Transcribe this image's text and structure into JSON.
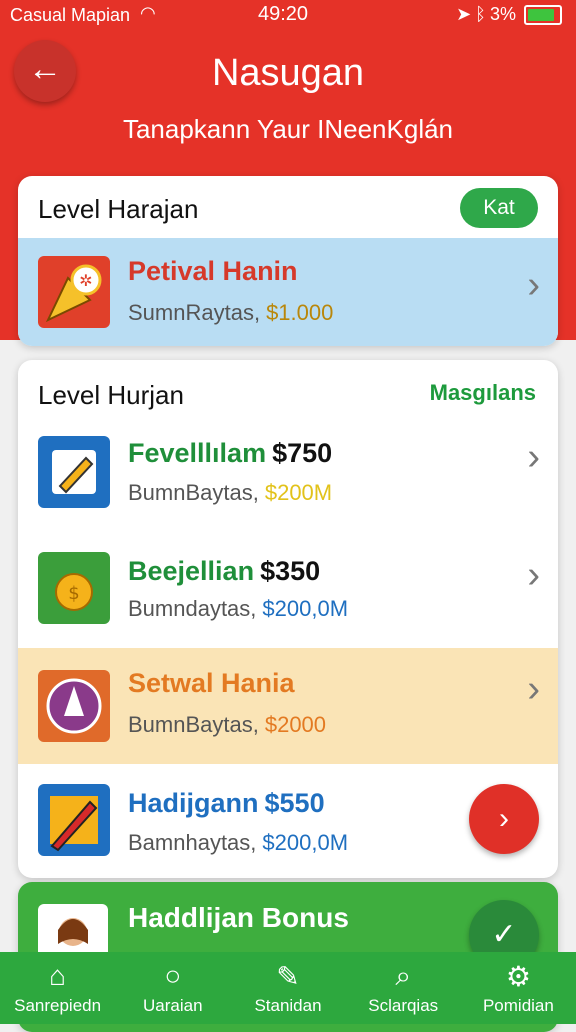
{
  "status": {
    "carrier": "Casual Mapian",
    "time": "49:20",
    "battery": "3%"
  },
  "header": {
    "title": "Nasugan",
    "subtitle": "Tanapkann Yaur INeenKglán"
  },
  "card1": {
    "title": "Level Harajan",
    "button": "Kat",
    "item": {
      "name": "Petival Hanin",
      "sub": "SumnRaytas,",
      "amount": "$1.000"
    }
  },
  "card2": {
    "title": "Level Hurjan",
    "action": "Masgılans",
    "items": [
      {
        "name": "Fevelllılam",
        "price": "$750",
        "sub": "BumnBaytas,",
        "amount": "$200M"
      },
      {
        "name": "Beejellian",
        "price": "$350",
        "sub": "Bumndaytas,",
        "amount": "$200,0M"
      },
      {
        "name": "Setwal Hania",
        "price": "",
        "sub": "BumnBaytas,",
        "amount": "$2000"
      },
      {
        "name": "Hadijgann",
        "price": "$550",
        "sub": "Bamnhaytas,",
        "amount": "$200,0M"
      }
    ]
  },
  "card3": {
    "title": "Haddlijan Bonus"
  },
  "nav": [
    {
      "label": "Sanrepiedn"
    },
    {
      "label": "Uaraian"
    },
    {
      "label": "Stanidan"
    },
    {
      "label": "Sclarqias"
    },
    {
      "label": "Pomidian"
    }
  ]
}
